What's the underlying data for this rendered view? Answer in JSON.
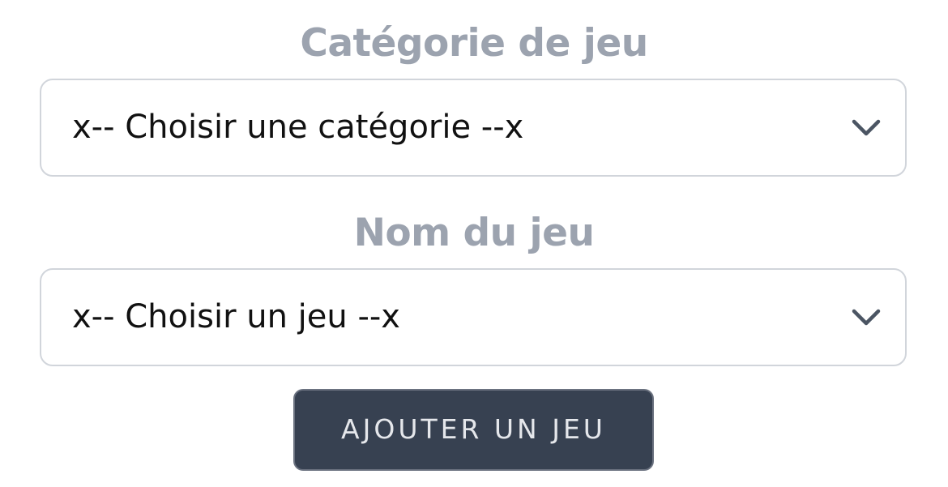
{
  "form": {
    "category": {
      "label": "Catégorie de jeu",
      "selected": "x-- Choisir une catégorie --x",
      "icon": "chevron-down-icon"
    },
    "game": {
      "label": "Nom du jeu",
      "selected": "x-- Choisir un jeu --x",
      "icon": "chevron-down-icon"
    },
    "submit_label": "AJOUTER UN JEU"
  },
  "colors": {
    "label": "#9ca3af",
    "select_border": "#d1d5db",
    "button_bg": "#374151",
    "button_text": "#e5e7eb"
  }
}
